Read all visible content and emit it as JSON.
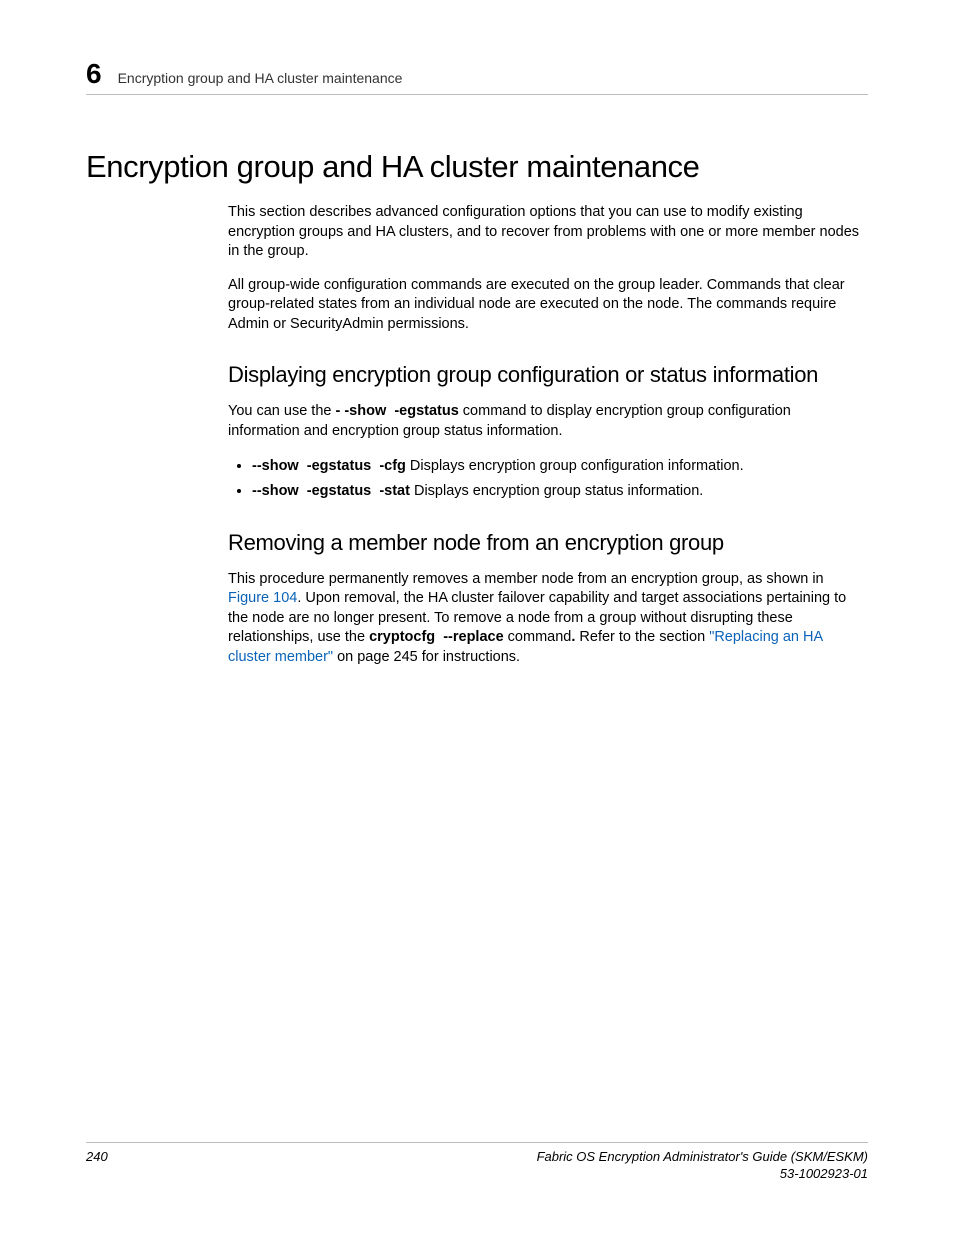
{
  "header": {
    "chapter_number": "6",
    "running_title": "Encryption group and HA cluster maintenance"
  },
  "title": "Encryption group and HA cluster maintenance",
  "intro_p1": "This section describes advanced configuration options that you can use to modify existing encryption groups and HA clusters, and to recover from problems with one or more member nodes in the group.",
  "intro_p2": "All group-wide configuration commands are executed on the group leader. Commands that clear group-related states from an individual node are executed on the node. The commands require Admin or SecurityAdmin permissions.",
  "section1": {
    "heading": "Displaying encryption group configuration or status information",
    "p1_a": "You can use the ",
    "p1_cmd1": "- -show",
    "p1_cmd2": "-egstatus",
    "p1_b": " command to display encryption group configuration information and encryption group status information.",
    "bullets": [
      {
        "c1": "--show",
        "c2": "-egstatus",
        "c3": "-cfg",
        "desc": " Displays encryption group configuration information."
      },
      {
        "c1": "--show",
        "c2": "-egstatus",
        "c3": "-stat",
        "desc": " Displays encryption group status information."
      }
    ]
  },
  "section2": {
    "heading": "Removing a member node from an encryption group",
    "p1_a": "This procedure permanently removes a member node from an encryption group, as shown in ",
    "p1_link1": "Figure 104",
    "p1_b": ". Upon removal, the HA cluster failover capability and target associations pertaining to the node are no longer present. To remove a node from a group without disrupting these relationships, use the ",
    "p1_cmd": "cryptocfg",
    "p1_cmd2": "--replace",
    "p1_c": " command",
    "p1_d": " Refer to the section ",
    "p1_link2": "\"Replacing an HA cluster member\"",
    "p1_e": " on page 245 for instructions."
  },
  "footer": {
    "page": "240",
    "doc_title": "Fabric OS Encryption Administrator's Guide (SKM/ESKM)",
    "doc_num": "53-1002923-01"
  }
}
